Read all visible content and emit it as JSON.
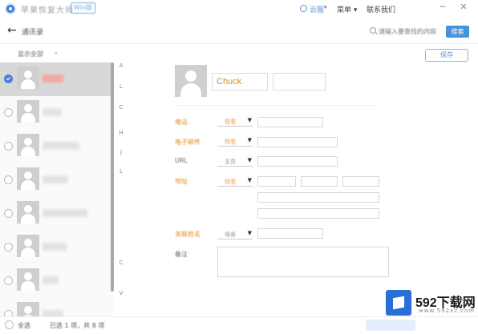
{
  "titlebar": {
    "app_title": "苹果恢复大师",
    "badge": "Win版",
    "user_label": "云服",
    "menu_label": "菜单",
    "contact_label": "联系我们",
    "minimize": "─",
    "close": "✕"
  },
  "toolbar": {
    "back_icon": "←",
    "page_title": "通讯录",
    "search_placeholder": "请输入要查找的内容",
    "search_button": "搜索"
  },
  "list": {
    "filter_label": "显示全部",
    "caret": "⌄",
    "alphabet": [
      "A",
      "L",
      "C",
      "H",
      "J",
      "L",
      "C",
      "V"
    ]
  },
  "detail": {
    "save_button": "保存",
    "first_name": "Chuck",
    "last_name": "",
    "rows": [
      {
        "label": "电话",
        "type": "住宅",
        "label_color": "orange"
      },
      {
        "label": "电子邮件",
        "type": "住宅",
        "label_color": "orange"
      },
      {
        "label": "URL",
        "type": "主页",
        "label_color": "gray"
      },
      {
        "label": "地址",
        "type": "住宅",
        "label_color": "orange"
      },
      {
        "label": "关联姓名",
        "type": "母亲",
        "label_color": "orange"
      },
      {
        "label": "备注",
        "type": "",
        "label_color": "gray"
      }
    ]
  },
  "footer": {
    "select_all": "全选",
    "count_text": "已选 1 项，共 8 项"
  },
  "watermark": {
    "brand": "592下载网",
    "url": "www.592xz.com"
  },
  "colors": {
    "accent": "#4a90e2",
    "label_orange": "#e08a1e",
    "selected_row": "#d8d8d8"
  }
}
